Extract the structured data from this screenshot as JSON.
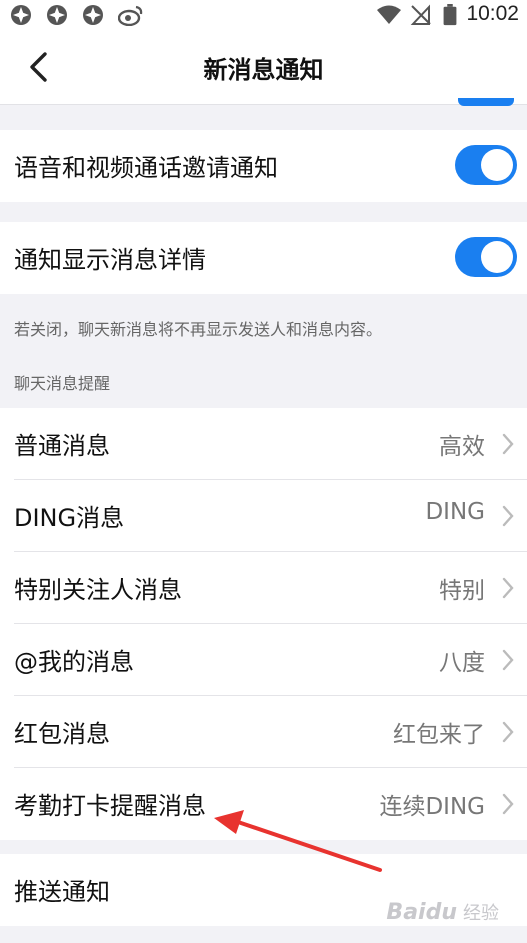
{
  "status_bar": {
    "time": "10:02",
    "left_icons": [
      "app-notification-icon",
      "app-notification-icon",
      "app-notification-icon",
      "weibo-icon"
    ],
    "right_icons": [
      "wifi-icon",
      "no-sim-icon",
      "battery-icon"
    ]
  },
  "header": {
    "title": "新消息通知",
    "back_icon": "chevron-left-icon"
  },
  "sections": {
    "call_invite": {
      "label": "语音和视频通话邀请通知",
      "toggle_on": true
    },
    "show_details": {
      "label": "通知显示消息详情",
      "toggle_on": true
    },
    "details_hint": "若关闭，聊天新消息将不再显示发送人和消息内容。",
    "chat_reminders_header": "聊天消息提醒",
    "chat_reminders": [
      {
        "label": "普通消息",
        "value": "高效"
      },
      {
        "label": "DING消息",
        "value": "DING"
      },
      {
        "label": "特别关注人消息",
        "value": "特别"
      },
      {
        "label": "@我的消息",
        "value": "八度"
      },
      {
        "label": "红包消息",
        "value": "红包来了"
      },
      {
        "label": "考勤打卡提醒消息",
        "value": "连续DING"
      }
    ],
    "push_notification": {
      "label": "推送通知"
    }
  },
  "annotation": {
    "arrow_color": "#e8332f"
  },
  "watermark": {
    "text": "Baidu",
    "sub": "经验"
  },
  "colors": {
    "accent": "#1a7ff0",
    "background": "#f2f2f6"
  }
}
